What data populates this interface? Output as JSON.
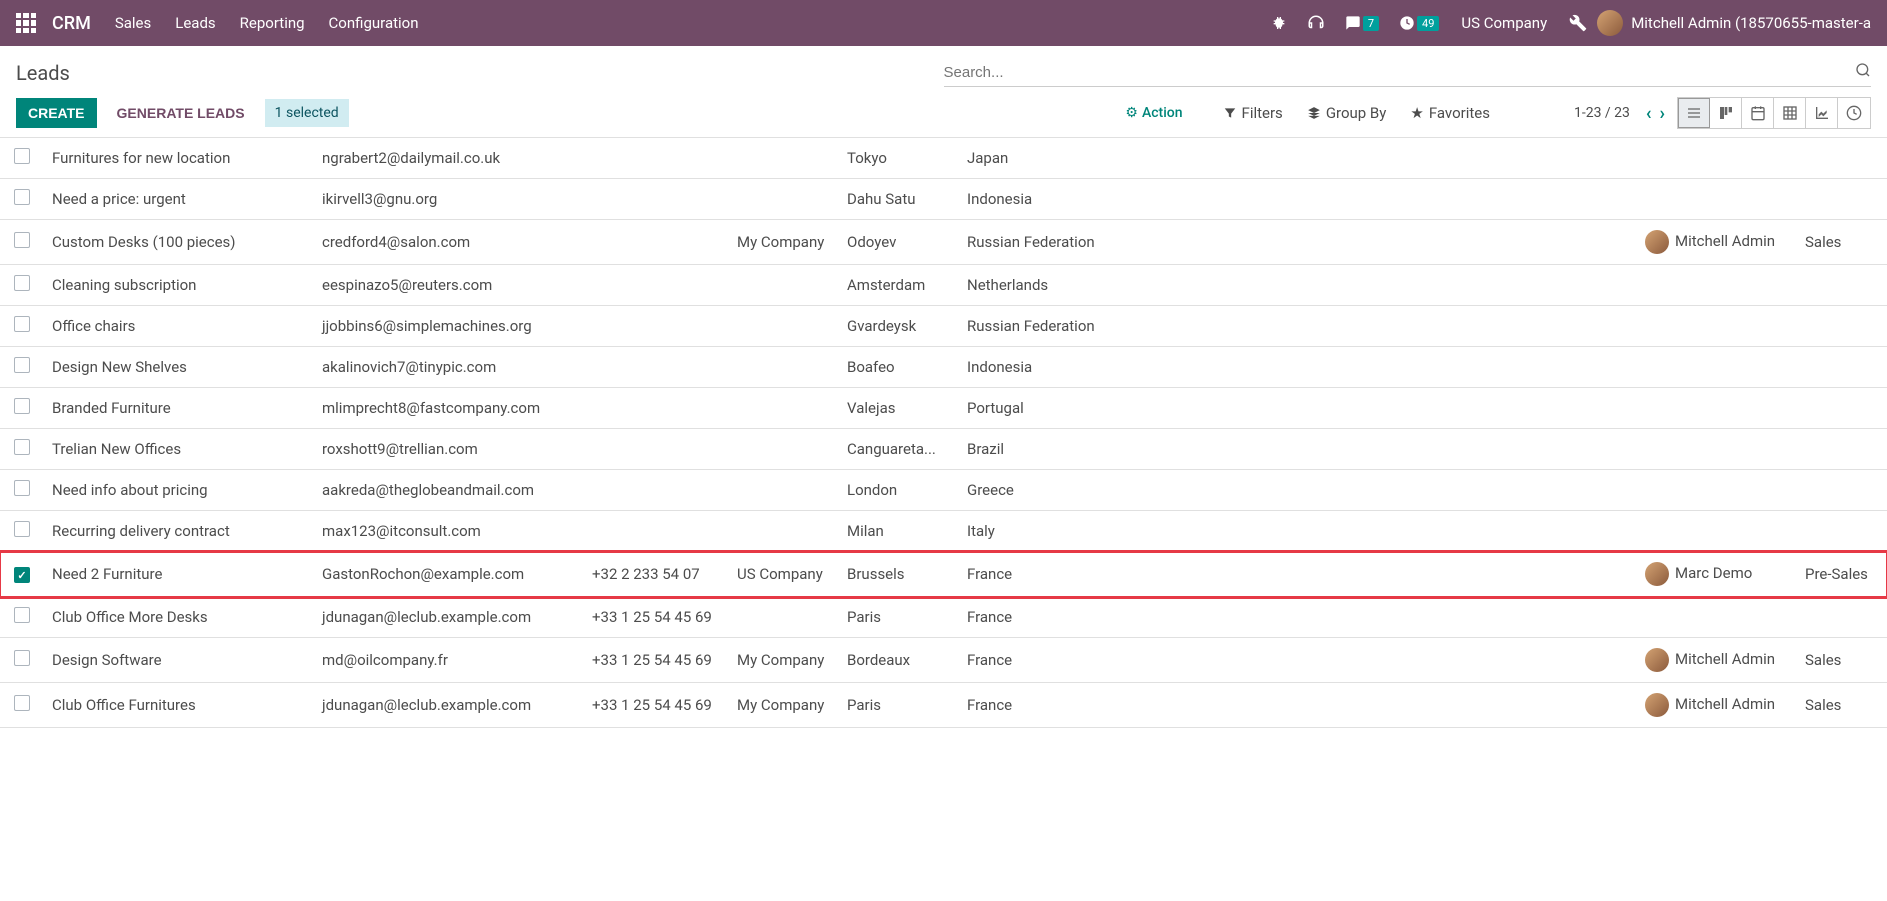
{
  "header": {
    "brand": "CRM",
    "nav": [
      "Sales",
      "Leads",
      "Reporting",
      "Configuration"
    ],
    "msg_badge": "7",
    "clock_badge": "49",
    "company": "US Company",
    "user": "Mitchell Admin (18570655-master-a"
  },
  "control": {
    "title": "Leads",
    "search_placeholder": "Search...",
    "create": "CREATE",
    "generate": "GENERATE LEADS",
    "selected": "1 selected",
    "action": "Action",
    "filters": "Filters",
    "groupby": "Group By",
    "favorites": "Favorites",
    "pager": "1-23 / 23"
  },
  "rows": [
    {
      "lead": "Furnitures for new location",
      "email": "ngrabert2@dailymail.co.uk",
      "phone": "",
      "company": "",
      "city": "Tokyo",
      "country": "Japan",
      "sales": "",
      "team": "",
      "checked": false,
      "avatar": false
    },
    {
      "lead": "Need a price: urgent",
      "email": "ikirvell3@gnu.org",
      "phone": "",
      "company": "",
      "city": "Dahu Satu",
      "country": "Indonesia",
      "sales": "",
      "team": "",
      "checked": false,
      "avatar": false
    },
    {
      "lead": "Custom Desks (100 pieces)",
      "email": "credford4@salon.com",
      "phone": "",
      "company": "My Company",
      "city": "Odoyev",
      "country": "Russian Federation",
      "sales": "Mitchell Admin",
      "team": "Sales",
      "checked": false,
      "avatar": true
    },
    {
      "lead": "Cleaning subscription",
      "email": "eespinazo5@reuters.com",
      "phone": "",
      "company": "",
      "city": "Amsterdam",
      "country": "Netherlands",
      "sales": "",
      "team": "",
      "checked": false,
      "avatar": false
    },
    {
      "lead": "Office chairs",
      "email": "jjobbins6@simplemachines.org",
      "phone": "",
      "company": "",
      "city": "Gvardeysk",
      "country": "Russian Federation",
      "sales": "",
      "team": "",
      "checked": false,
      "avatar": false
    },
    {
      "lead": "Design New Shelves",
      "email": "akalinovich7@tinypic.com",
      "phone": "",
      "company": "",
      "city": "Boafeo",
      "country": "Indonesia",
      "sales": "",
      "team": "",
      "checked": false,
      "avatar": false
    },
    {
      "lead": "Branded Furniture",
      "email": "mlimprecht8@fastcompany.com",
      "phone": "",
      "company": "",
      "city": "Valejas",
      "country": "Portugal",
      "sales": "",
      "team": "",
      "checked": false,
      "avatar": false
    },
    {
      "lead": "Trelian New Offices",
      "email": "roxshott9@trellian.com",
      "phone": "",
      "company": "",
      "city": "Canguareta...",
      "country": "Brazil",
      "sales": "",
      "team": "",
      "checked": false,
      "avatar": false
    },
    {
      "lead": "Need info about pricing",
      "email": "aakreda@theglobeandmail.com",
      "phone": "",
      "company": "",
      "city": "London",
      "country": "Greece",
      "sales": "",
      "team": "",
      "checked": false,
      "avatar": false
    },
    {
      "lead": "Recurring delivery contract",
      "email": "max123@itconsult.com",
      "phone": "",
      "company": "",
      "city": "Milan",
      "country": "Italy",
      "sales": "",
      "team": "",
      "checked": false,
      "avatar": false
    },
    {
      "lead": "Need 2 Furniture",
      "email": "GastonRochon@example.com",
      "phone": "+32 2 233 54 07",
      "company": "US Company",
      "city": "Brussels",
      "country": "France",
      "sales": "Marc Demo",
      "team": "Pre-Sales",
      "checked": true,
      "avatar": true,
      "highlight": true
    },
    {
      "lead": "Club Office More Desks",
      "email": "jdunagan@leclub.example.com",
      "phone": "+33 1 25 54 45 69",
      "company": "",
      "city": "Paris",
      "country": "France",
      "sales": "",
      "team": "",
      "checked": false,
      "avatar": false
    },
    {
      "lead": "Design Software",
      "email": "md@oilcompany.fr",
      "phone": "+33 1 25 54 45 69",
      "company": "My Company",
      "city": "Bordeaux",
      "country": "France",
      "sales": "Mitchell Admin",
      "team": "Sales",
      "checked": false,
      "avatar": true
    },
    {
      "lead": "Club Office Furnitures",
      "email": "jdunagan@leclub.example.com",
      "phone": "+33 1 25 54 45 69",
      "company": "My Company",
      "city": "Paris",
      "country": "France",
      "sales": "Mitchell Admin",
      "team": "Sales",
      "checked": false,
      "avatar": true
    }
  ]
}
